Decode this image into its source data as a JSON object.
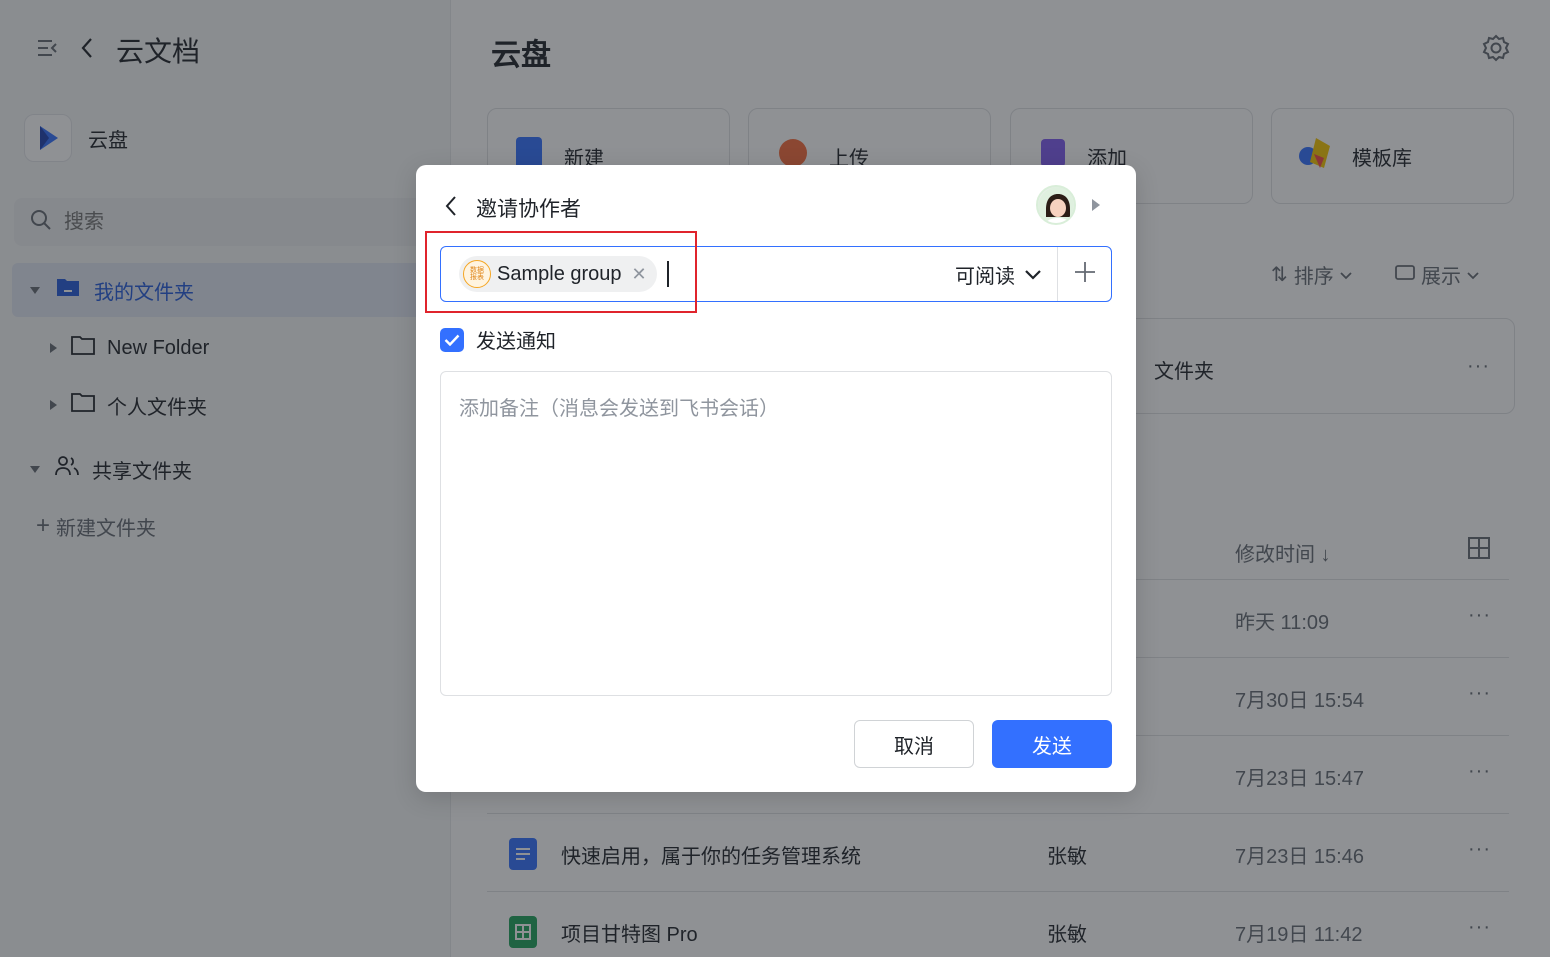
{
  "sidebar": {
    "app_title": "云文档",
    "drive_label": "云盘",
    "search_placeholder": "搜索",
    "tree": {
      "my_folder": "我的文件夹",
      "new_folder": "New Folder",
      "personal_folder": "个人文件夹",
      "shared_folder": "共享文件夹",
      "create_folder": "新建文件夹"
    }
  },
  "main": {
    "title": "云盘",
    "actions": {
      "new": "新建",
      "upload": "上传",
      "add": "添加",
      "templates": "模板库"
    },
    "toolbar": {
      "sort": "排序",
      "view": "展示"
    },
    "folder_card_text": "文件夹",
    "list_header": {
      "modified": "修改时间 ↓"
    },
    "rows": [
      {
        "name": "",
        "owner": "",
        "time": "昨天 11:09"
      },
      {
        "name": "",
        "owner": "",
        "time": "7月30日 15:54"
      },
      {
        "name": "",
        "owner": "",
        "time": "7月23日 15:47"
      },
      {
        "name": "快速启用，属于你的任务管理系统",
        "owner": "张敏",
        "time": "7月23日 15:46"
      },
      {
        "name": "项目甘特图 Pro",
        "owner": "张敏",
        "time": "7月19日 11:42"
      }
    ],
    "more_glyph": "···"
  },
  "modal": {
    "title": "邀请协作者",
    "chip": {
      "label": "Sample group",
      "icon_text_line1": "数据",
      "icon_text_line2": "报表"
    },
    "permission": "可阅读",
    "notify_label": "发送通知",
    "note_placeholder": "添加备注（消息会发送到飞书会话）",
    "cancel": "取消",
    "send": "发送"
  },
  "colors": {
    "primary": "#3370ff",
    "highlight": "#e0242c",
    "sheet_green": "#1ea35a",
    "doc_blue": "#3370ff"
  }
}
